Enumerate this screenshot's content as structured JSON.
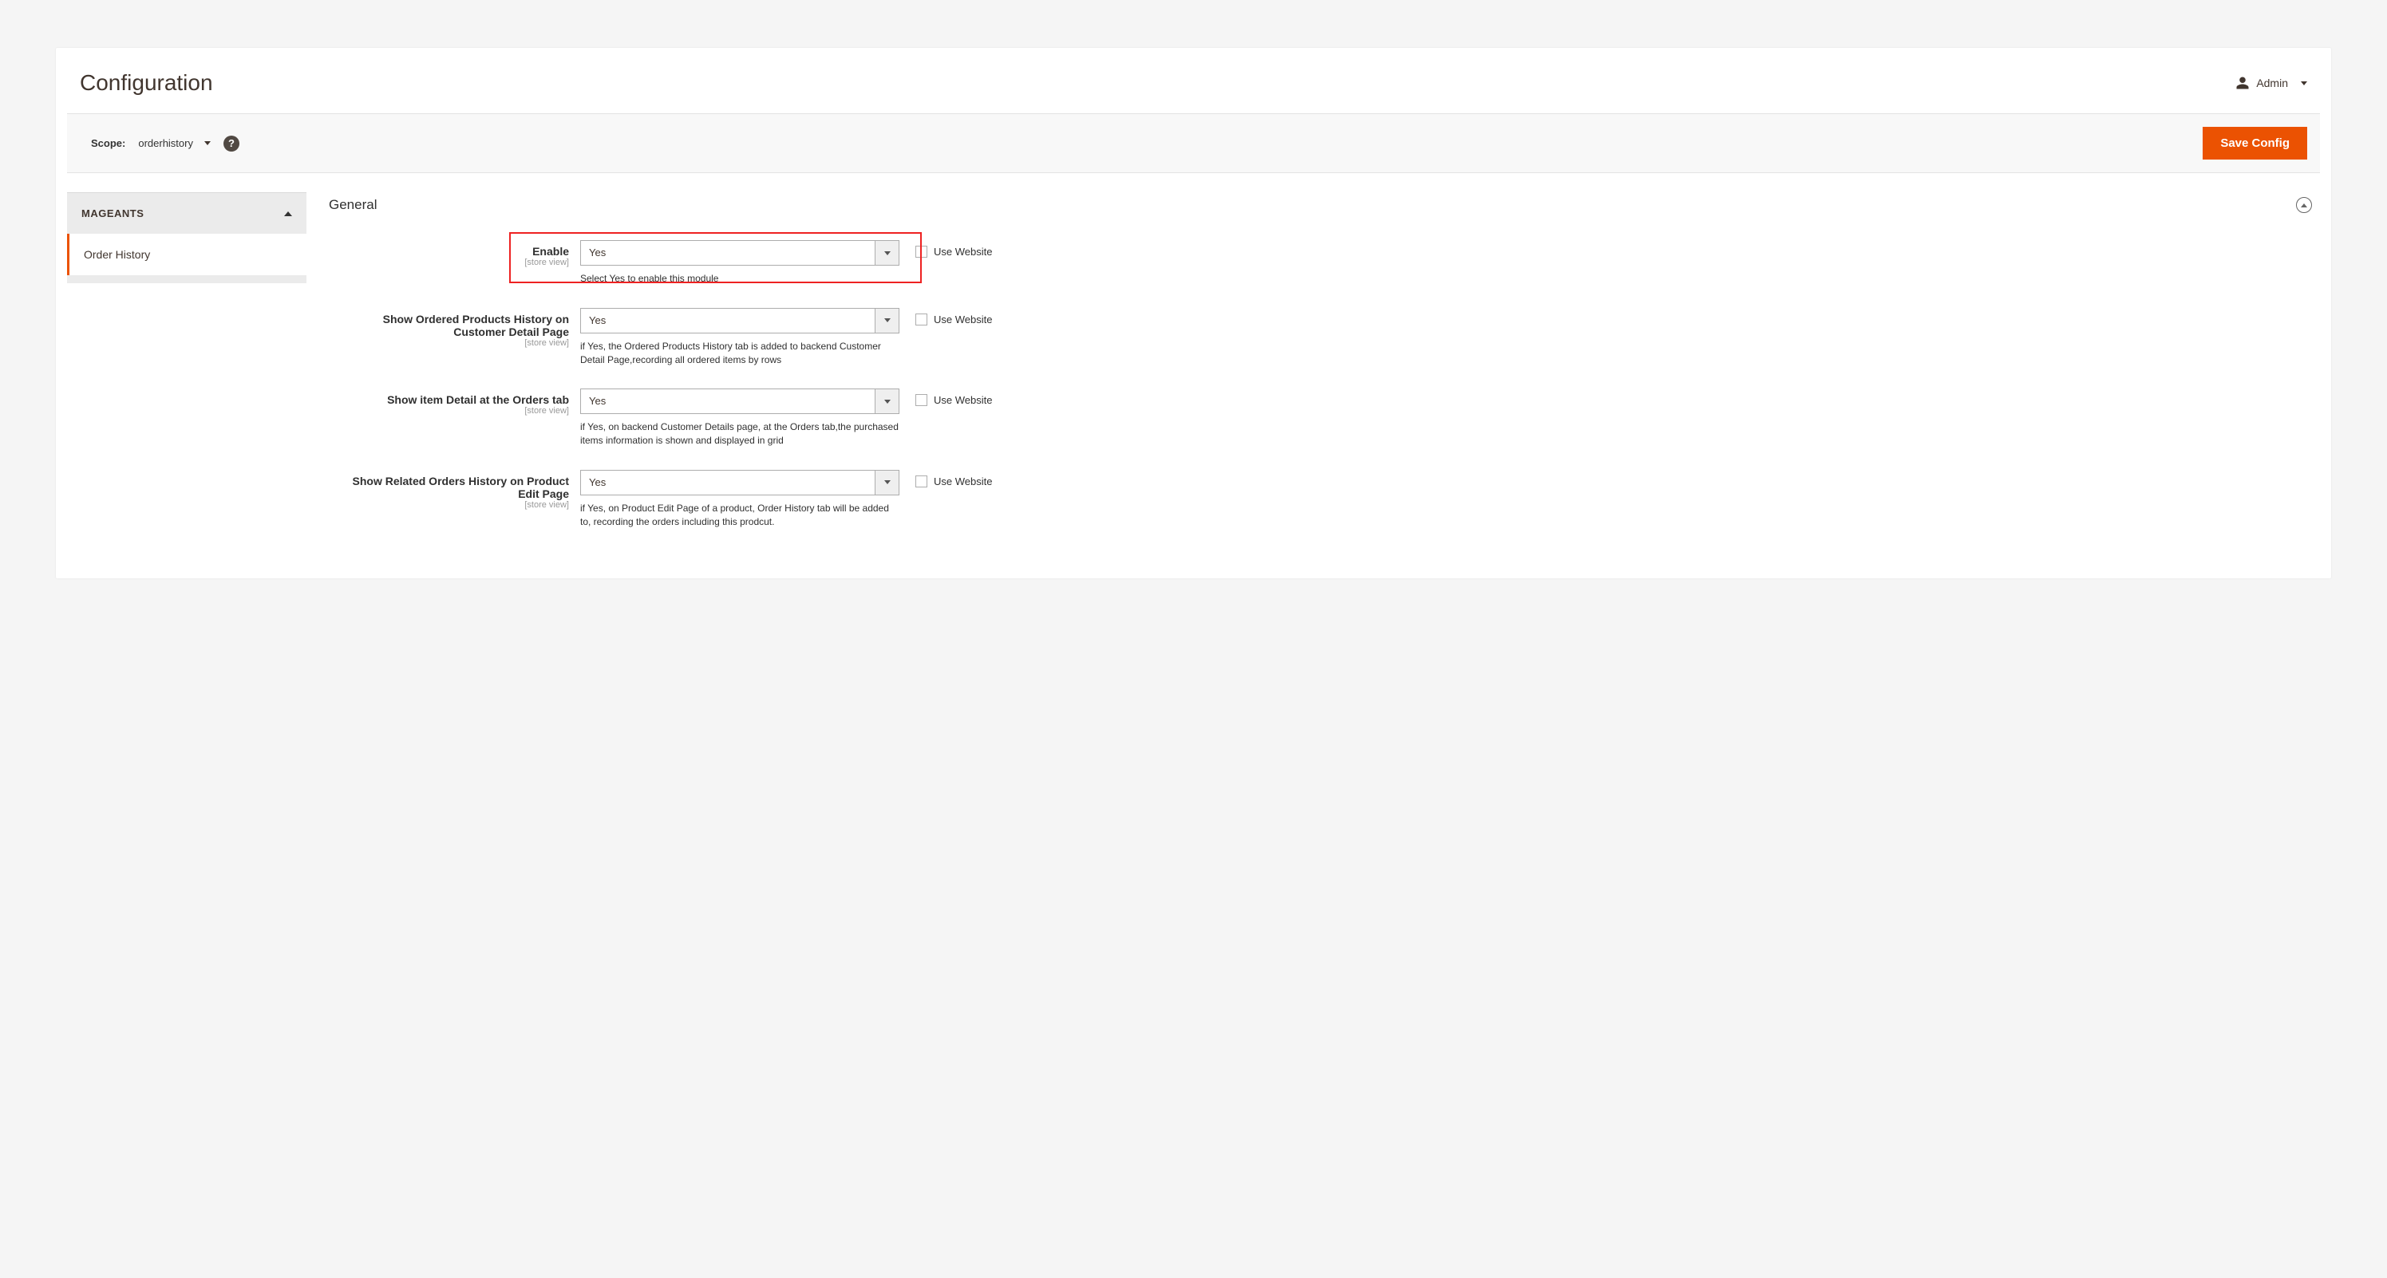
{
  "page": {
    "title": "Configuration"
  },
  "user": {
    "name": "Admin"
  },
  "toolbar": {
    "scope_label": "Scope:",
    "scope_value": "orderhistory",
    "save_label": "Save Config"
  },
  "sidebar": {
    "group_label": "MAGEANTS",
    "item_label": "Order History"
  },
  "section": {
    "title": "General"
  },
  "fields": {
    "enable": {
      "label": "Enable",
      "scope": "[store view]",
      "value": "Yes",
      "note": "Select Yes to enable this module",
      "use_website": "Use Website"
    },
    "show_customer": {
      "label": "Show Ordered Products History on Customer Detail Page",
      "scope": "[store view]",
      "value": "Yes",
      "note": "if Yes, the Ordered Products History tab is added to backend Customer Detail Page,recording all ordered items by rows",
      "use_website": "Use Website"
    },
    "show_item_detail": {
      "label": "Show item Detail at the Orders tab",
      "scope": "[store view]",
      "value": "Yes",
      "note": "if Yes, on backend Customer Details page, at the Orders tab,the purchased items information is shown and displayed in grid",
      "use_website": "Use Website"
    },
    "show_related": {
      "label": "Show Related Orders History on Product Edit Page",
      "scope": "[store view]",
      "value": "Yes",
      "note": "if Yes, on Product Edit Page of a product, Order History tab will be added to, recording the orders including this prodcut.",
      "use_website": "Use Website"
    }
  }
}
